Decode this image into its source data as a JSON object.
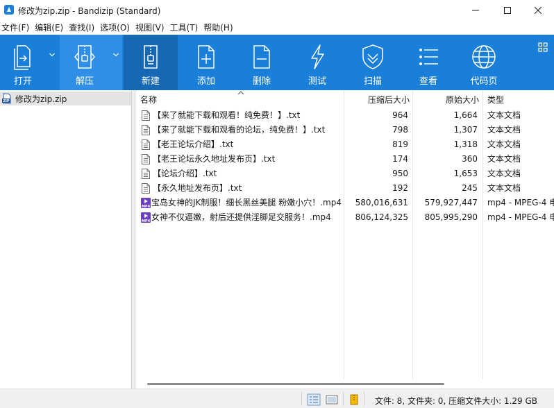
{
  "window": {
    "title": "修改为zip.zip - Bandizip (Standard)"
  },
  "menu": [
    "文件(F)",
    "编辑(E)",
    "查找(I)",
    "选项(O)",
    "视图(V)",
    "工具(T)",
    "帮助(H)"
  ],
  "toolbar": {
    "open_label": "打开",
    "extract_label": "解压",
    "new_label": "新建",
    "add_label": "添加",
    "delete_label": "删除",
    "test_label": "测试",
    "scan_label": "扫描",
    "view_label": "查看",
    "codepage_label": "代码页"
  },
  "tree": {
    "archive_name": "修改为zip.zip",
    "archive_icon_text": "ZIP"
  },
  "columns": {
    "name": "名称",
    "packed": "压缩后大小",
    "original": "原始大小",
    "type": "类型"
  },
  "files": [
    {
      "name": "【来了就能下载和观看！纯免费！】.txt",
      "packed": "964",
      "original": "1,664",
      "type": "文本文档",
      "kind": "txt"
    },
    {
      "name": "【来了就能下载和观看的论坛，纯免费！】.txt",
      "packed": "798",
      "original": "1,307",
      "type": "文本文档",
      "kind": "txt"
    },
    {
      "name": "【老王论坛介绍】.txt",
      "packed": "819",
      "original": "1,318",
      "type": "文本文档",
      "kind": "txt"
    },
    {
      "name": "【老王论坛永久地址发布页】.txt",
      "packed": "174",
      "original": "360",
      "type": "文本文档",
      "kind": "txt"
    },
    {
      "name": "【论坛介绍】.txt",
      "packed": "950",
      "original": "1,653",
      "type": "文本文档",
      "kind": "txt"
    },
    {
      "name": "【永久地址发布页】.txt",
      "packed": "192",
      "original": "245",
      "type": "文本文档",
      "kind": "txt"
    },
    {
      "name": "宝岛女神的JK制服！细长黑丝美腿 粉嫩小穴！.mp4",
      "packed": "580,016,631",
      "original": "579,927,447",
      "type": "mp4 - MPEG-4 电",
      "kind": "mp4"
    },
    {
      "name": "女神不仅逼嫩，射后还提供淫脚足交服务！.mp4",
      "packed": "806,124,325",
      "original": "805,995,290",
      "type": "mp4 - MPEG-4 电",
      "kind": "mp4"
    }
  ],
  "mp4_icon_text": "MP4",
  "status": {
    "text": "文件: 8, 文件夹: 0, 压缩文件大小: 1.29 GB"
  },
  "colors": {
    "toolbar_bg": "#1a7fd8",
    "toolbar_active": "#1667b4",
    "toolbar_hover": "#2f8fe6",
    "mp4_icon": "#6a3fc4"
  }
}
